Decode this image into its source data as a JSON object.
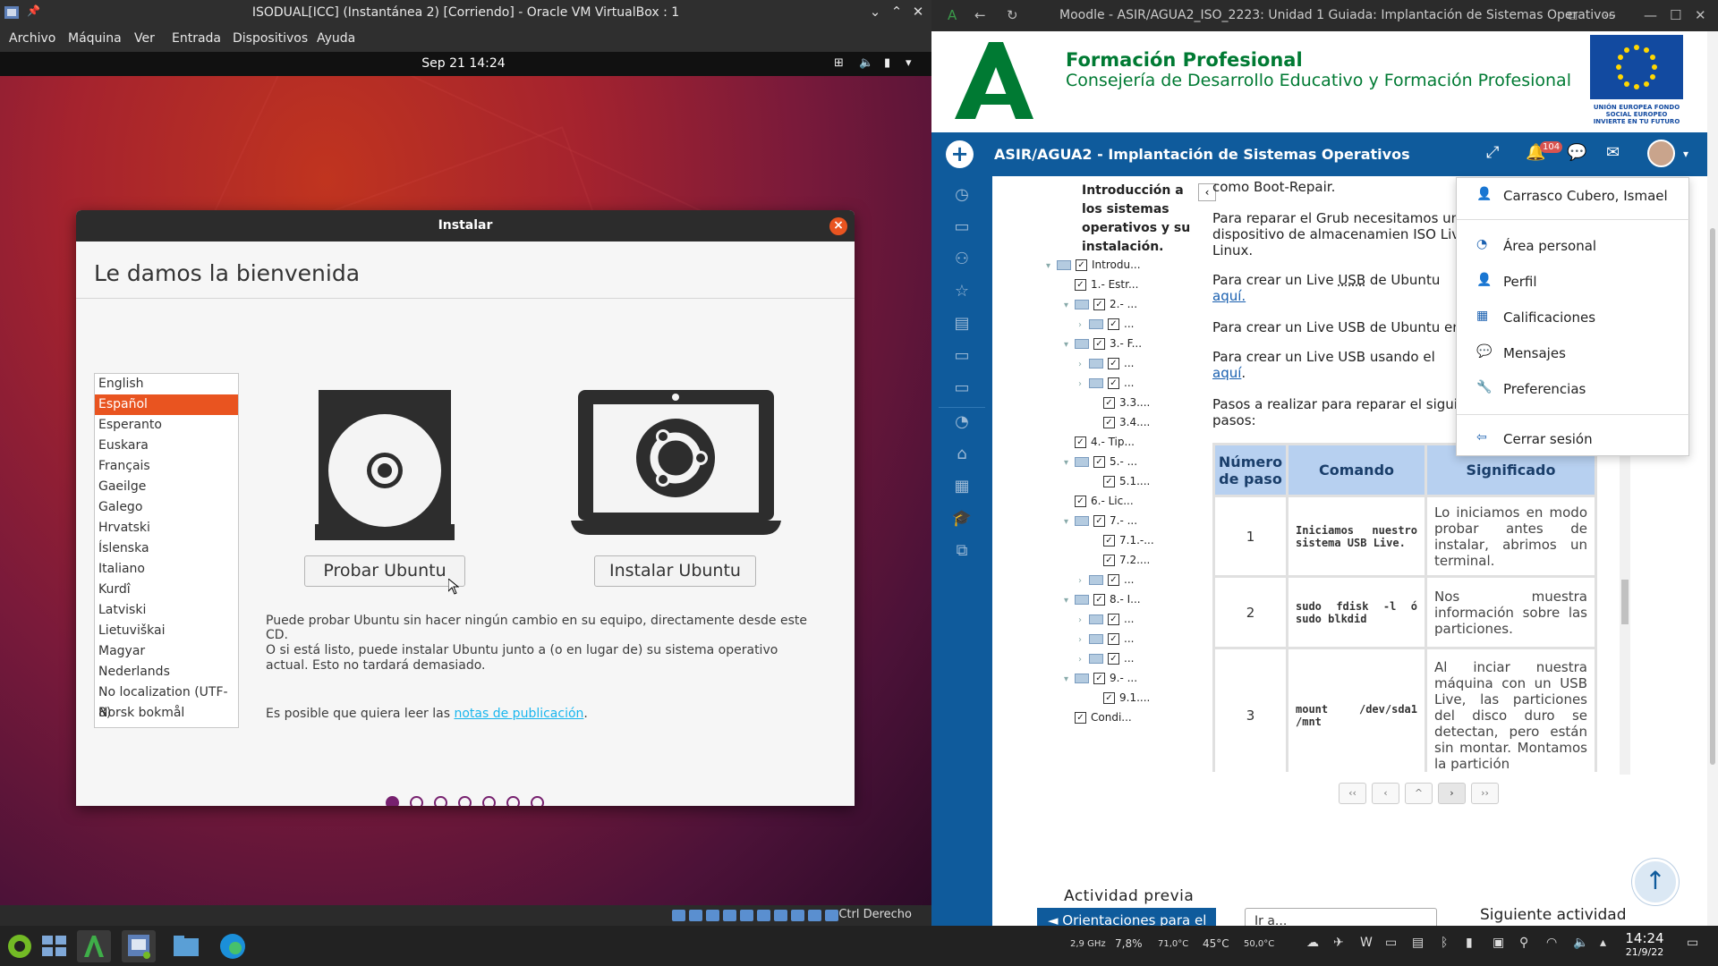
{
  "vbox": {
    "title": "ISODUAL[ICC] (Instantánea 2) [Corriendo] - Oracle VM VirtualBox : 1",
    "menu": [
      "Archivo",
      "Máquina",
      "Ver",
      "Entrada",
      "Dispositivos",
      "Ayuda"
    ],
    "host_key": "Ctrl Derecho"
  },
  "gnome": {
    "clock": "Sep 21  14:24"
  },
  "installer": {
    "title": "Instalar",
    "heading": "Le damos la bienvenida",
    "languages": [
      "English",
      "Español",
      "Esperanto",
      "Euskara",
      "Français",
      "Gaeilge",
      "Galego",
      "Hrvatski",
      "Íslenska",
      "Italiano",
      "Kurdî",
      "Latviski",
      "Lietuviškai",
      "Magyar",
      "Nederlands",
      "No localization (UTF-8)",
      "Norsk bokmål"
    ],
    "selected_language": "Español",
    "try_button": "Probar Ubuntu",
    "install_button": "Instalar Ubuntu",
    "text1": "Puede probar Ubuntu sin hacer ningún cambio en su equipo, directamente desde este CD.",
    "text2": "O si está listo, puede instalar Ubuntu junto a (o en lugar de) su sistema operativo actual. Esto no tardará demasiado.",
    "text3_prefix": "Es posible que quiera leer las",
    "text3_link": "notas de publicación",
    "text3_suffix": ".",
    "steps_total": 7,
    "step_current": 1
  },
  "browser": {
    "title": "Moodle - ASIR/AGUA2_ISO_2223: Unidad 1 Guiada: Implantación de Sistemas Operativos",
    "banner_l1": "Formación Profesional",
    "banner_l2": "Consejería de Desarrollo Educativo y Formación Profesional",
    "eu_text": "UNIÓN EUROPEA FONDO SOCIAL EUROPEO INVIERTE EN TU FUTURO",
    "course": "ASIR/AGUA2 - Implantación de Sistemas Operativos",
    "notifications": "104",
    "toc_title": "Introducción a los sistemas operativos y su instalación.",
    "toc": [
      "Introdu...",
      "1.- Estr...",
      "2.- ...",
      "...",
      "3.- F...",
      "...",
      "...",
      "3.3....",
      "3.4....",
      "4.- Tip...",
      "5.- ...",
      "5.1....",
      "6.- Lic...",
      "7.- ...",
      "7.1.-...",
      "7.2....",
      "...",
      "8.- I...",
      "...",
      "...",
      "...",
      "9.- ...",
      "9.1....",
      "Condi..."
    ],
    "p0": "como Boot-Repair.",
    "p1": "Para reparar el Grub necesitamos un cualquier dispositivo de almacenamien ISO Live de tu distribución Linux.",
    "p2_prefix": "Para crear un Live",
    "p2_usb": "USB",
    "p2_mid": "de Ubuntu",
    "p2_link": "aquí.",
    "p3": "Para crear un Live USB de Ubuntu en",
    "p4_prefix": "Para crear un Live USB  usando el",
    "p4_link": "aquí",
    "p5": "Pasos a realizar para reparar el siguiendo los siguientes pasos:",
    "table_headers": [
      "Número de paso",
      "Comando",
      "Significado"
    ],
    "table_rows": [
      {
        "n": "1",
        "cmd": "Iniciamos nuestro sistema USB Live.",
        "sig": "Lo iniciamos en modo probar antes de instalar, abrimos un terminal."
      },
      {
        "n": "2",
        "cmd": "sudo fdisk -l ó sudo blkdid",
        "sig": "Nos muestra información sobre las particiones."
      },
      {
        "n": "3",
        "cmd": "mount /dev/sda1 /mnt",
        "sig": "Al inciar nuestra máquina con un USB Live, las particiones del disco duro se detectan, pero están sin montar. Montamos la partición"
      }
    ],
    "pager": [
      "‹‹",
      "‹",
      "^",
      "›",
      "››"
    ],
    "prev_label": "Actividad previa",
    "prev_button": "◄ Orientaciones para el",
    "goto": "Ir a...",
    "next_label": "Siguiente actividad",
    "user_menu": {
      "name": "Carrasco Cubero, Ismael",
      "items": [
        "Área personal",
        "Perfil",
        "Calificaciones",
        "Mensajes",
        "Preferencias"
      ],
      "logout": "Cerrar sesión"
    }
  },
  "taskbar": {
    "cpu_freq": "2,9 GHz",
    "cpu_load": "7,8%",
    "temp1": "71,0°C",
    "temp2": "45°C",
    "temp3": "50,0°C",
    "time": "14:24",
    "date": "21/9/22"
  },
  "colors": {
    "ubuntu_orange": "#e95420",
    "moodle_blue": "#0f5b9c",
    "junta_green": "#007a33",
    "aubergine": "#77216f"
  }
}
